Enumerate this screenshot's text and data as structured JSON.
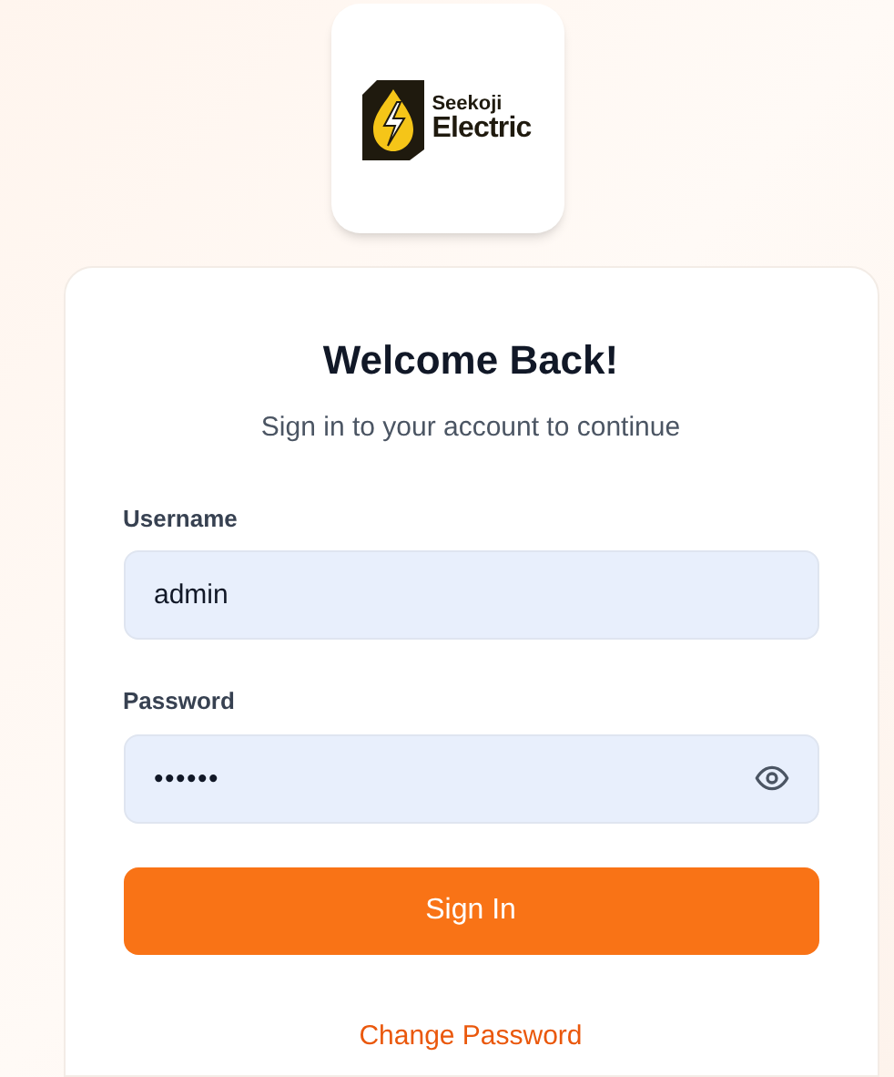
{
  "logo": {
    "line1": "Seekoji",
    "line2": "Electric"
  },
  "title": "Welcome Back!",
  "subtitle": "Sign in to your account to continue",
  "fields": [
    {
      "label": "Username",
      "value": "admin",
      "kind": "text"
    },
    {
      "label": "Password",
      "value": "••••••",
      "kind": "password"
    }
  ],
  "submit": "Sign In",
  "link": "Change Password"
}
